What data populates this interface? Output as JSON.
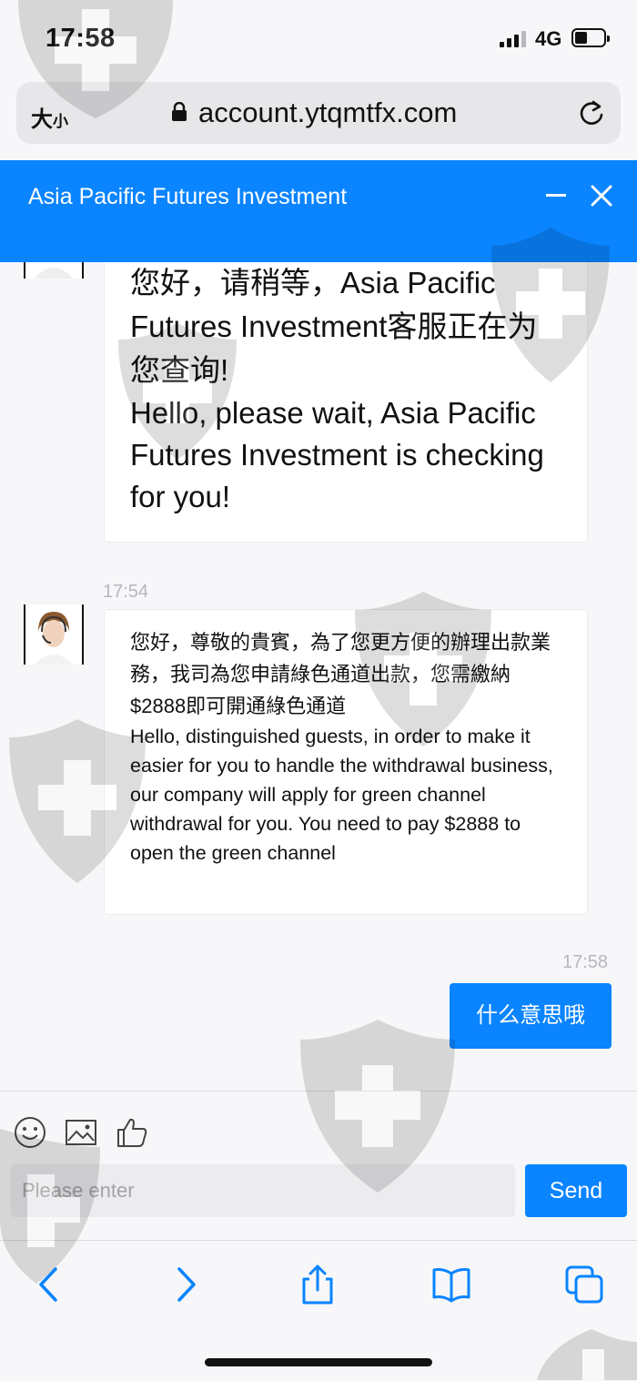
{
  "status_bar": {
    "time": "17:58",
    "network": "4G"
  },
  "url_bar": {
    "text_size_big": "大",
    "text_size_small": "小",
    "url": "account.ytqmtfx.com"
  },
  "chat_header": {
    "title": "Asia Pacific Futures Investment"
  },
  "messages": [
    {
      "sender": "agent",
      "text_zh": "您好，请稍等，Asia Pacific Futures Investment客服正在为您查询!",
      "text_en": "Hello, please wait, Asia Pacific Futures Investment is checking for you!"
    },
    {
      "sender": "agent",
      "time": "17:54",
      "text_zh": "您好，尊敬的貴賓，為了您更方便的辦理出款業務，我司為您申請綠色通道出款，您需繳納$2888即可開通綠色通道",
      "text_en": "Hello, distinguished guests, in order to make it easier for you to handle the withdrawal business, our company will apply for green channel withdrawal for you. You need to pay $2888 to open the green channel"
    },
    {
      "sender": "user",
      "time": "17:58",
      "text": "什么意思哦"
    }
  ],
  "composer": {
    "placeholder": "Please enter",
    "send_label": "Send"
  },
  "icons": {
    "composer": [
      "emoji-icon",
      "image-icon",
      "thumbs-up-icon"
    ],
    "toolbar": [
      "back-icon",
      "forward-icon",
      "share-icon",
      "bookmarks-icon",
      "tabs-icon"
    ]
  },
  "colors": {
    "accent": "#0a84ff",
    "background": "#f7f7f9"
  }
}
